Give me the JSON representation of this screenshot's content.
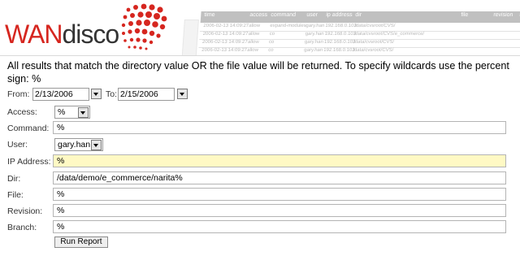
{
  "brand": {
    "name_part1": "WAN",
    "name_part2": "disco",
    "accent": "#d6261f"
  },
  "background_table": {
    "headers": [
      "time",
      "access",
      "command",
      "user",
      "ip address",
      "dir",
      "file",
      "revision",
      "branch"
    ],
    "rows": [
      [
        "2006-02-13 14:09:27",
        "allow",
        "expand-modules",
        "gary.han",
        "192.168.0.103",
        "/data/cvsroot/CVS/",
        "",
        "",
        "rel-1"
      ],
      [
        "2006-02-13 14:09:27",
        "allow",
        "co",
        "gary.han",
        "192.168.0.103",
        "/data/cvsroot/CVS/e_commerce/",
        "",
        "",
        "rel-1"
      ],
      [
        "2006-02-13 14:09:27",
        "allow",
        "co",
        "gary.han",
        "192.168.0.103",
        "/data/cvsroot/CVS/",
        "",
        "",
        "rel-1"
      ],
      [
        "2006-02-13 14:09:27",
        "allow",
        "co",
        "gary.han",
        "192.168.0.103",
        "/data/cvsroot/CVS/",
        "",
        "",
        "rel-1"
      ]
    ]
  },
  "intro_text": "All results that match the directory value OR the file value will be returned. To specify wildcards use the percent sign: %",
  "form": {
    "from_label": "From:",
    "from_value": "2/13/2006",
    "to_label": "To:",
    "to_value": "2/15/2006",
    "access_label": "Access:",
    "access_value": "%",
    "command_label": "Command:",
    "command_value": "%",
    "user_label": "User:",
    "user_value": "gary.han",
    "ip_label": "IP Address:",
    "ip_value": "%",
    "dir_label": "Dir:",
    "dir_value": "/data/demo/e_commerce/narita%",
    "file_label": "File:",
    "file_value": "%",
    "revision_label": "Revision:",
    "revision_value": "%",
    "branch_label": "Branch:",
    "branch_value": "%",
    "run_label": "Run Report",
    "highlight_color": "#fff9c4"
  }
}
